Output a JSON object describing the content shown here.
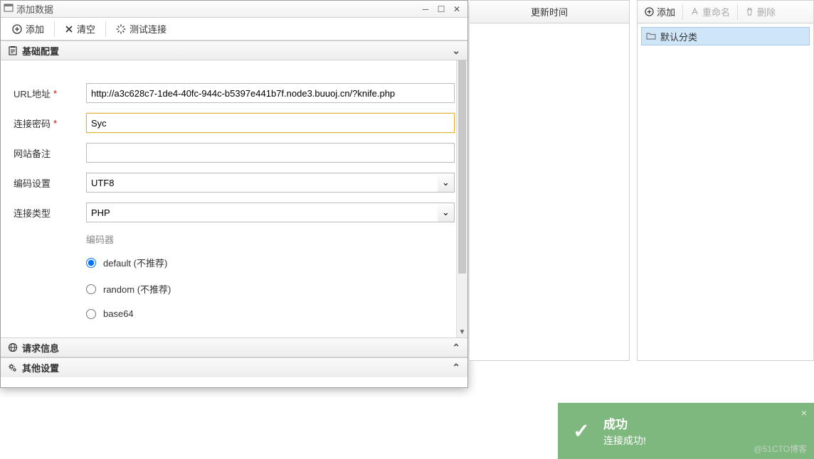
{
  "dialog": {
    "title": "添加数据",
    "toolbar": {
      "add": "添加",
      "clear": "清空",
      "test": "测试连接"
    },
    "accordion": {
      "basic": "基础配置",
      "request": "请求信息",
      "other": "其他设置"
    },
    "form": {
      "url_label": "URL地址",
      "url_value": "http://a3c628c7-1de4-40fc-944c-b5397e441b7f.node3.buuoj.cn/?knife.php",
      "pwd_label": "连接密码",
      "pwd_value": "Syc",
      "note_label": "网站备注",
      "note_value": "",
      "encode_label": "编码设置",
      "encode_value": "UTF8",
      "type_label": "连接类型",
      "type_value": "PHP",
      "encoder_title": "编码器",
      "encoders": [
        {
          "label": "default (不推荐)",
          "checked": true
        },
        {
          "label": "random (不推荐)",
          "checked": false
        },
        {
          "label": "base64",
          "checked": false
        }
      ]
    }
  },
  "mid_panel": {
    "header": "更新时间"
  },
  "right_panel": {
    "toolbar": {
      "add": "添加",
      "rename": "重命名",
      "delete": "删除"
    },
    "category": "默认分类"
  },
  "toast": {
    "title": "成功",
    "msg": "连接成功!"
  },
  "watermark": "@51CTO博客"
}
